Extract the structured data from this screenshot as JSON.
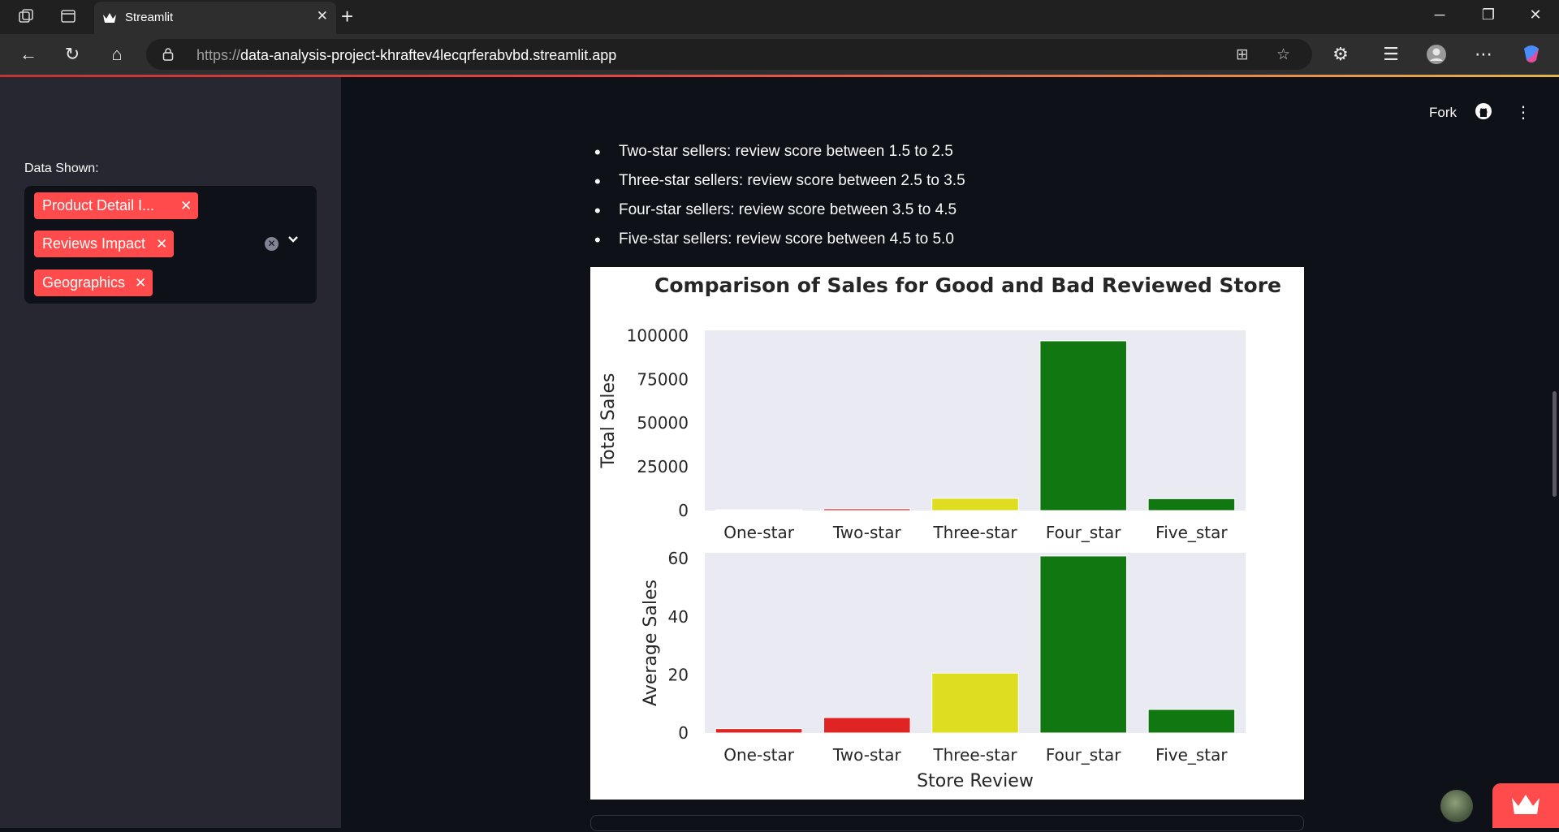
{
  "browser": {
    "tab_title": "Streamlit",
    "url_scheme": "https://",
    "url_host": "data-analysis-project-khraftev4lecqrferabvbd.streamlit.app"
  },
  "sidebar": {
    "label": "Data Shown:",
    "chips": [
      {
        "label": "Product Detail I..."
      },
      {
        "label": "Reviews Impact"
      },
      {
        "label": "Geographics"
      }
    ]
  },
  "header": {
    "fork_label": "Fork"
  },
  "main": {
    "bullets": [
      "Two-star sellers: review score between 1.5 to 2.5",
      "Three-star sellers: review score between 2.5 to 3.5",
      "Four-star sellers: review score between 3.5 to 4.5",
      "Five-star sellers: review score between 4.5 to 5.0"
    ]
  },
  "chart_data": {
    "type": "bar",
    "title": "Comparison of Sales for Good and Bad Reviewed Store",
    "xlabel": "Store Review",
    "categories": [
      "One-star",
      "Two-star",
      "Three-star",
      "Four_star",
      "Five_star"
    ],
    "colors": [
      "#e02424",
      "#e02424",
      "#dedd20",
      "#117711",
      "#117711"
    ],
    "panels": [
      {
        "ylabel": "Total Sales",
        "ylim": [
          0,
          103000
        ],
        "yticks": [
          0,
          25000,
          50000,
          75000,
          100000
        ],
        "values": [
          400,
          1000,
          7000,
          97000,
          6800
        ]
      },
      {
        "ylabel": "Average Sales",
        "ylim": [
          0,
          62
        ],
        "yticks": [
          0,
          20,
          40,
          60
        ],
        "values": [
          1.5,
          5.3,
          20.6,
          60.9,
          8.1
        ]
      }
    ],
    "grid": false,
    "background": "#eaeaf2"
  }
}
